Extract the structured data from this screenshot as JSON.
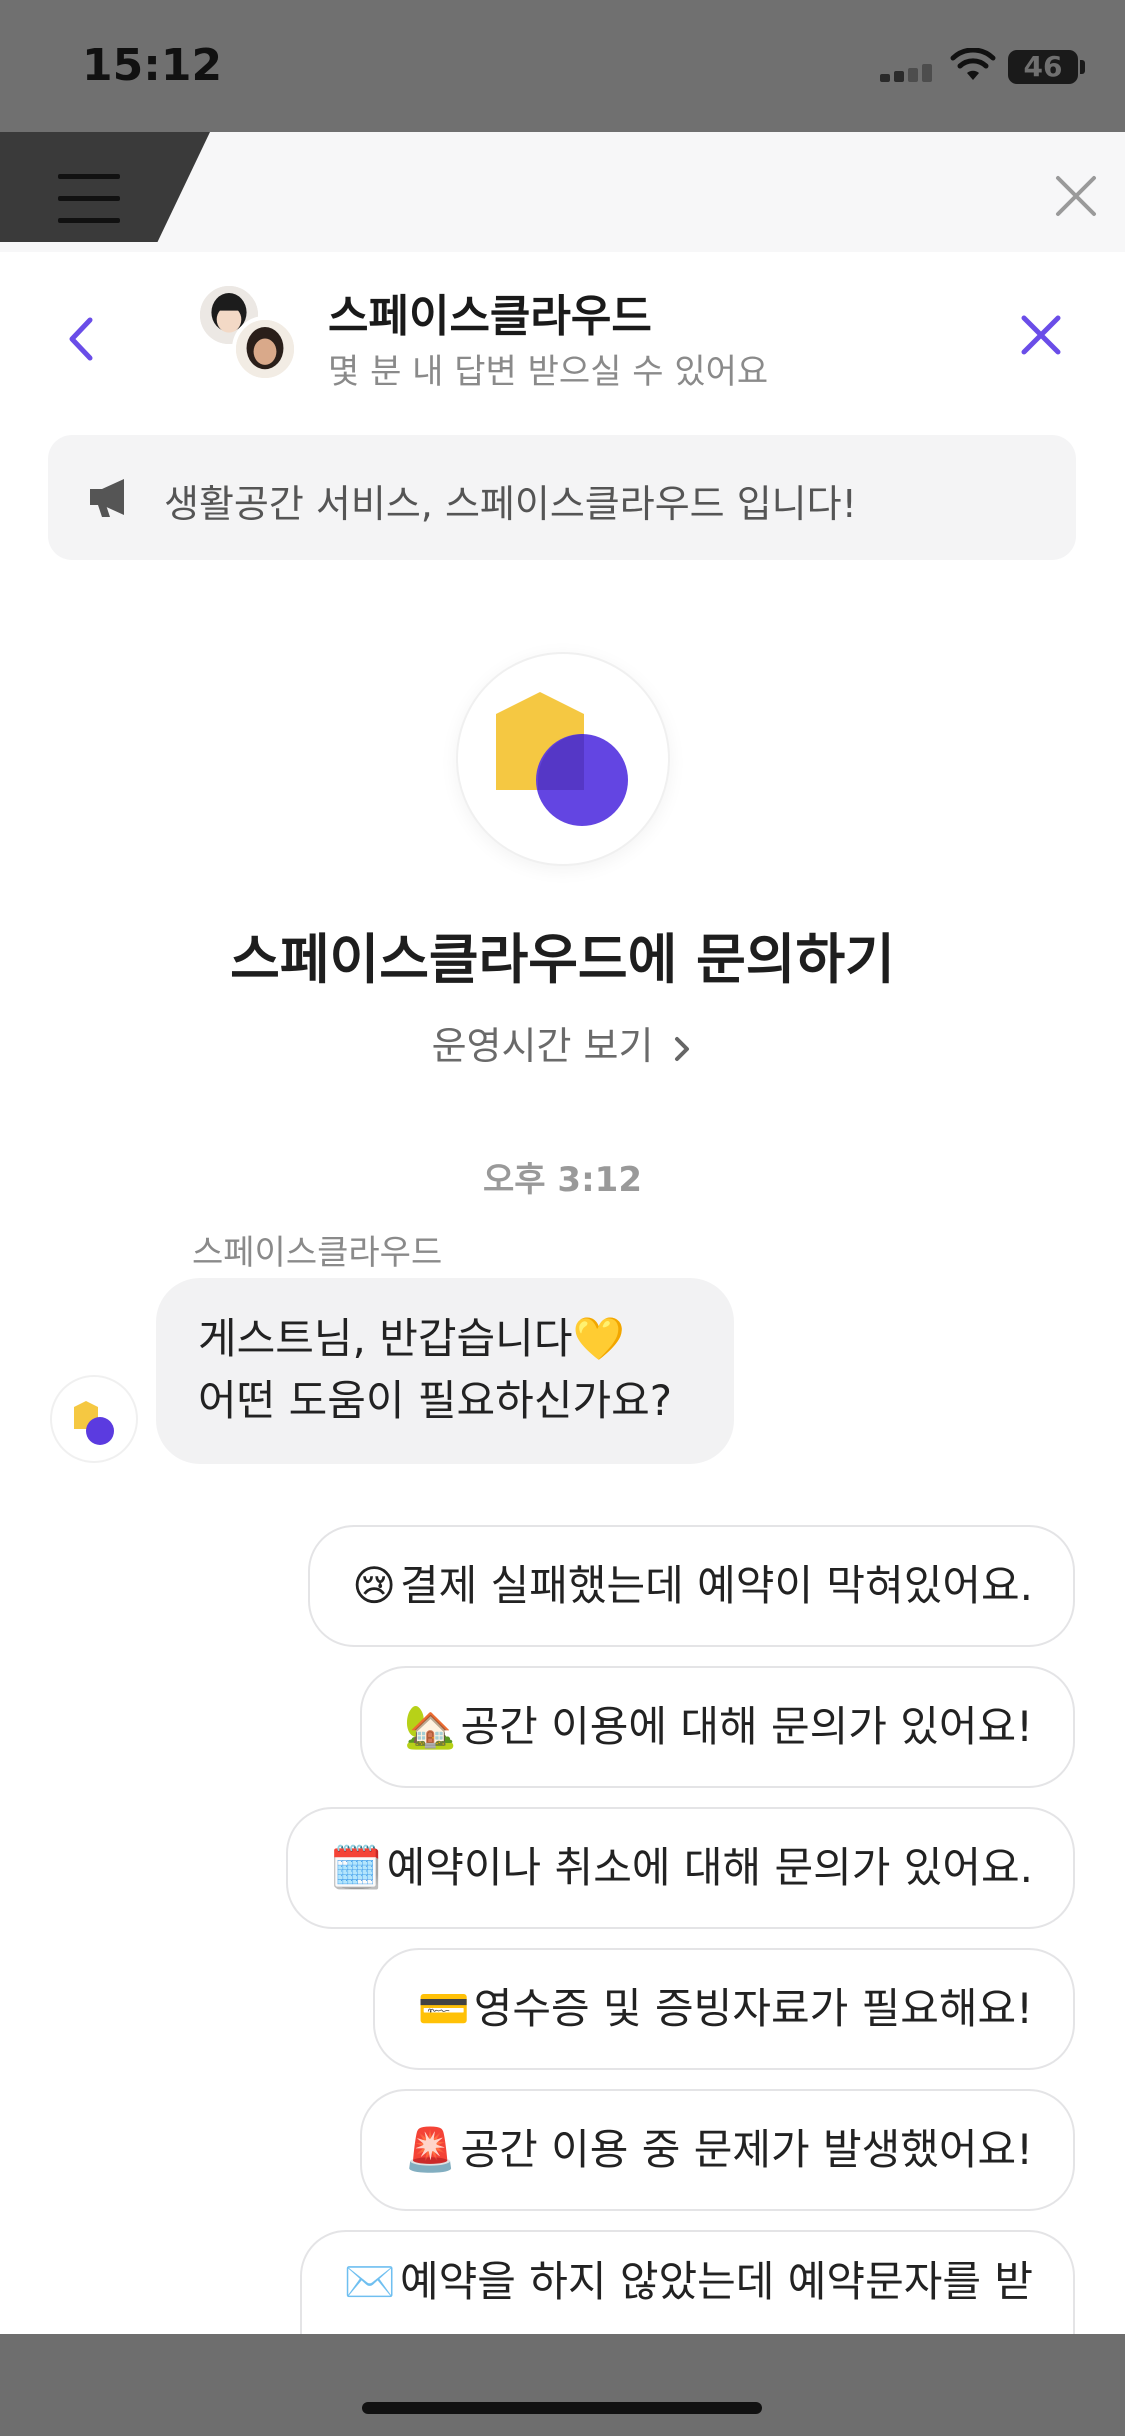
{
  "status_bar": {
    "time": "15:12",
    "battery": "46"
  },
  "header": {
    "title": "스페이스클라우드",
    "subtitle": "몇 분 내 답변 받으실 수 있어요"
  },
  "notice": {
    "text": "생활공간 서비스, 스페이스클라우드 입니다!"
  },
  "brand": {
    "title": "스페이스클라우드에 문의하기",
    "hours_link": "운영시간 보기",
    "logo_colors": {
      "house": "#F5C842",
      "circle": "#5B3BE0"
    }
  },
  "chat": {
    "timestamp": "오후 3:12",
    "sender": "스페이스클라우드",
    "message_line1": "게스트님, 반갑습니다💛",
    "message_line2": "어떤 도움이 필요하신가요?"
  },
  "options": [
    {
      "emoji": "😢",
      "label": "결제 실패했는데 예약이 막혀있어요."
    },
    {
      "emoji": "🏡",
      "label": "공간 이용에 대해 문의가 있어요!"
    },
    {
      "emoji": "🗓️",
      "label": "예약이나 취소에 대해 문의가 있어요."
    },
    {
      "emoji": "💳",
      "label": "영수증 및 증빙자료가 필요해요!"
    },
    {
      "emoji": "🚨",
      "label": "공간 이용 중 문제가 발생했어요!"
    },
    {
      "emoji": "✉️",
      "label": "예약을 하지 않았는데 예약문자를 받"
    }
  ],
  "accent_color": "#6A4DE8"
}
